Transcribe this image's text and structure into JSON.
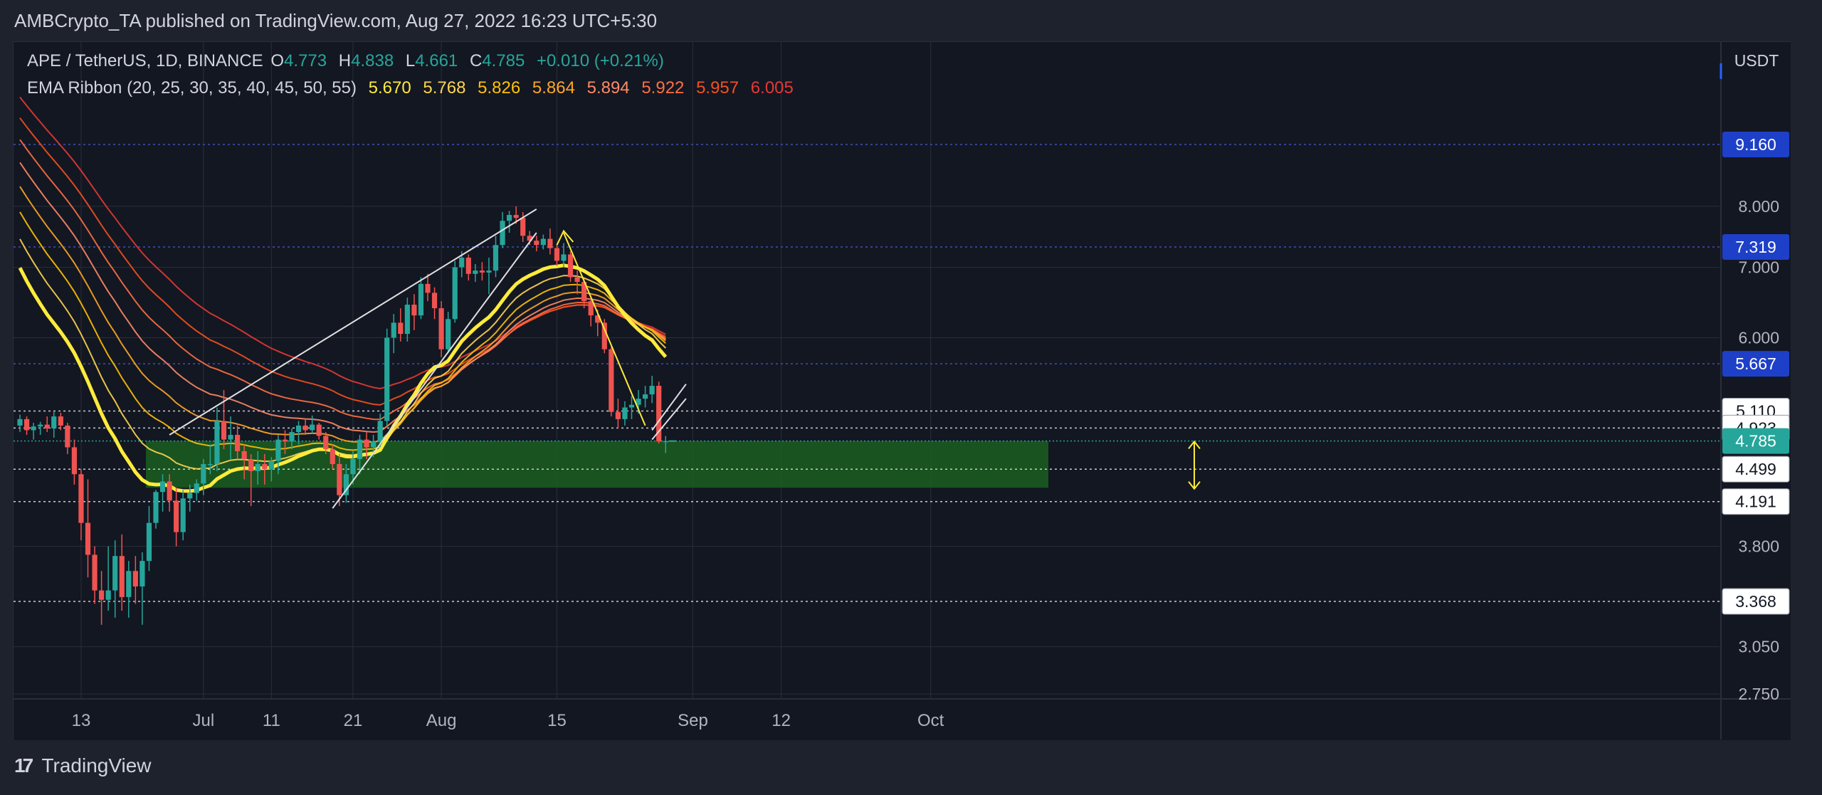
{
  "header": {
    "published": "AMBCrypto_TA published on TradingView.com, Aug 27, 2022 16:23 UTC+5:30"
  },
  "legend": {
    "symbol": "APE / TetherUS, 1D, BINANCE",
    "open_label": "O",
    "open": "4.773",
    "high_label": "H",
    "high": "4.838",
    "low_label": "L",
    "low": "4.661",
    "close_label": "C",
    "close": "4.785",
    "change": "+0.010 (+0.21%)",
    "ema_title": "EMA Ribbon (20, 25, 30, 35, 40, 45, 50, 55)",
    "ema_values": [
      "5.670",
      "5.768",
      "5.826",
      "5.864",
      "5.894",
      "5.922",
      "5.957",
      "6.005"
    ],
    "ema_colors": [
      "#ffeb3b",
      "#ffd54f",
      "#ffc107",
      "#ffa726",
      "#ff8a65",
      "#ff7043",
      "#f4511e",
      "#e53935"
    ]
  },
  "footer": {
    "brand": "TradingView",
    "logo": "17"
  },
  "colors": {
    "up": "#26a69a",
    "down": "#ef5350",
    "bg": "#131722",
    "grid": "#2a2e39",
    "zone": "#1b5e20",
    "highlight": "#2962ff",
    "label_bg": "#ffffff",
    "current": "#26a69a"
  },
  "chart_data": {
    "type": "candlestick",
    "currency": "USDT",
    "x_tick_labels": [
      "13",
      "Jul",
      "11",
      "21",
      "Aug",
      "15",
      "Sep",
      "12",
      "Oct"
    ],
    "y_tick_labels": [
      "2.750",
      "3.050",
      "3.800",
      "6.000",
      "7.000",
      "8.000"
    ],
    "price_labels": [
      {
        "value": "9.160",
        "style": "blue"
      },
      {
        "value": "7.319",
        "style": "blue"
      },
      {
        "value": "5.667",
        "style": "blue"
      },
      {
        "value": "5.110",
        "style": "white"
      },
      {
        "value": "4.923",
        "style": "white"
      },
      {
        "value": "4.785",
        "style": "current"
      },
      {
        "value": "4.499",
        "style": "white"
      },
      {
        "value": "4.191",
        "style": "white"
      },
      {
        "value": "3.368",
        "style": "white"
      }
    ],
    "candles": [
      {
        "d": "Jun 04",
        "o": 4.95,
        "h": 5.07,
        "l": 4.88,
        "c": 5.02
      },
      {
        "d": "Jun 05",
        "o": 5.02,
        "h": 5.05,
        "l": 4.85,
        "c": 4.9
      },
      {
        "d": "Jun 06",
        "o": 4.9,
        "h": 4.98,
        "l": 4.8,
        "c": 4.94
      },
      {
        "d": "Jun 07",
        "o": 4.94,
        "h": 4.99,
        "l": 4.85,
        "c": 4.96
      },
      {
        "d": "Jun 08",
        "o": 4.96,
        "h": 5.05,
        "l": 4.88,
        "c": 4.92
      },
      {
        "d": "Jun 09",
        "o": 4.92,
        "h": 5.1,
        "l": 4.82,
        "c": 5.05
      },
      {
        "d": "Jun 10",
        "o": 5.05,
        "h": 5.09,
        "l": 4.9,
        "c": 4.95
      },
      {
        "d": "Jun 11",
        "o": 4.95,
        "h": 4.98,
        "l": 4.65,
        "c": 4.72
      },
      {
        "d": "Jun 12",
        "o": 4.72,
        "h": 4.8,
        "l": 4.35,
        "c": 4.45
      },
      {
        "d": "Jun 13",
        "o": 4.45,
        "h": 4.5,
        "l": 3.85,
        "c": 4.0
      },
      {
        "d": "Jun 14",
        "o": 4.0,
        "h": 4.4,
        "l": 3.55,
        "c": 3.73
      },
      {
        "d": "Jun 15",
        "o": 3.73,
        "h": 3.8,
        "l": 3.35,
        "c": 3.45
      },
      {
        "d": "Jun 16",
        "o": 3.45,
        "h": 3.6,
        "l": 3.2,
        "c": 3.38
      },
      {
        "d": "Jun 17",
        "o": 3.38,
        "h": 3.8,
        "l": 3.3,
        "c": 3.45
      },
      {
        "d": "Jun 18",
        "o": 3.45,
        "h": 3.85,
        "l": 3.25,
        "c": 3.72
      },
      {
        "d": "Jun 19",
        "o": 3.72,
        "h": 3.9,
        "l": 3.3,
        "c": 3.4
      },
      {
        "d": "Jun 20",
        "o": 3.4,
        "h": 3.68,
        "l": 3.25,
        "c": 3.6
      },
      {
        "d": "Jun 21",
        "o": 3.6,
        "h": 3.72,
        "l": 3.35,
        "c": 3.48
      },
      {
        "d": "Jun 22",
        "o": 3.48,
        "h": 3.75,
        "l": 3.2,
        "c": 3.68
      },
      {
        "d": "Jun 23",
        "o": 3.68,
        "h": 4.15,
        "l": 3.6,
        "c": 4.0
      },
      {
        "d": "Jun 24",
        "o": 4.0,
        "h": 4.3,
        "l": 3.95,
        "c": 4.28
      },
      {
        "d": "Jun 25",
        "o": 4.28,
        "h": 4.45,
        "l": 4.1,
        "c": 4.38
      },
      {
        "d": "Jun 26",
        "o": 4.38,
        "h": 4.45,
        "l": 4.1,
        "c": 4.2
      },
      {
        "d": "Jun 27",
        "o": 4.2,
        "h": 4.32,
        "l": 3.8,
        "c": 3.92
      },
      {
        "d": "Jun 28",
        "o": 3.92,
        "h": 4.3,
        "l": 3.85,
        "c": 4.22
      },
      {
        "d": "Jun 29",
        "o": 4.22,
        "h": 4.35,
        "l": 4.1,
        "c": 4.27
      },
      {
        "d": "Jun 30",
        "o": 4.27,
        "h": 4.4,
        "l": 4.2,
        "c": 4.36
      },
      {
        "d": "Jul 01",
        "o": 4.36,
        "h": 4.6,
        "l": 4.25,
        "c": 4.55
      },
      {
        "d": "Jul 02",
        "o": 4.55,
        "h": 4.75,
        "l": 4.45,
        "c": 4.55
      },
      {
        "d": "Jul 03",
        "o": 4.55,
        "h": 5.15,
        "l": 4.48,
        "c": 5.0
      },
      {
        "d": "Jul 04",
        "o": 5.0,
        "h": 5.35,
        "l": 4.7,
        "c": 4.8
      },
      {
        "d": "Jul 05",
        "o": 4.8,
        "h": 5.05,
        "l": 4.6,
        "c": 4.85
      },
      {
        "d": "Jul 06",
        "o": 4.85,
        "h": 4.95,
        "l": 4.6,
        "c": 4.68
      },
      {
        "d": "Jul 07",
        "o": 4.68,
        "h": 4.75,
        "l": 4.4,
        "c": 4.6
      },
      {
        "d": "Jul 08",
        "o": 4.6,
        "h": 4.65,
        "l": 4.15,
        "c": 4.48
      },
      {
        "d": "Jul 09",
        "o": 4.48,
        "h": 4.68,
        "l": 4.35,
        "c": 4.55
      },
      {
        "d": "Jul 10",
        "o": 4.55,
        "h": 4.65,
        "l": 4.35,
        "c": 4.5
      },
      {
        "d": "Jul 11",
        "o": 4.5,
        "h": 4.62,
        "l": 4.38,
        "c": 4.58
      },
      {
        "d": "Jul 12",
        "o": 4.58,
        "h": 4.85,
        "l": 4.45,
        "c": 4.8
      },
      {
        "d": "Jul 13",
        "o": 4.8,
        "h": 4.9,
        "l": 4.65,
        "c": 4.78
      },
      {
        "d": "Jul 14",
        "o": 4.78,
        "h": 4.92,
        "l": 4.7,
        "c": 4.88
      },
      {
        "d": "Jul 15",
        "o": 4.88,
        "h": 5.0,
        "l": 4.75,
        "c": 4.95
      },
      {
        "d": "Jul 16",
        "o": 4.95,
        "h": 5.02,
        "l": 4.85,
        "c": 4.9
      },
      {
        "d": "Jul 17",
        "o": 4.9,
        "h": 5.06,
        "l": 4.86,
        "c": 4.96
      },
      {
        "d": "Jul 18",
        "o": 4.96,
        "h": 4.98,
        "l": 4.8,
        "c": 4.84
      },
      {
        "d": "Jul 19",
        "o": 4.84,
        "h": 4.88,
        "l": 4.65,
        "c": 4.7
      },
      {
        "d": "Jul 20",
        "o": 4.7,
        "h": 4.75,
        "l": 4.5,
        "c": 4.55
      },
      {
        "d": "Jul 21",
        "o": 4.55,
        "h": 4.65,
        "l": 4.15,
        "c": 4.25
      },
      {
        "d": "Jul 22",
        "o": 4.25,
        "h": 4.55,
        "l": 4.18,
        "c": 4.45
      },
      {
        "d": "Jul 23",
        "o": 4.45,
        "h": 4.68,
        "l": 4.35,
        "c": 4.6
      },
      {
        "d": "Jul 24",
        "o": 4.6,
        "h": 4.85,
        "l": 4.45,
        "c": 4.8
      },
      {
        "d": "Jul 25",
        "o": 4.8,
        "h": 4.88,
        "l": 4.6,
        "c": 4.72
      },
      {
        "d": "Jul 26",
        "o": 4.72,
        "h": 4.85,
        "l": 4.62,
        "c": 4.78
      },
      {
        "d": "Jul 27",
        "o": 4.78,
        "h": 5.08,
        "l": 4.72,
        "c": 5.0
      },
      {
        "d": "Jul 28",
        "o": 5.0,
        "h": 6.12,
        "l": 4.95,
        "c": 6.0
      },
      {
        "d": "Jul 29",
        "o": 6.0,
        "h": 6.32,
        "l": 5.8,
        "c": 6.2
      },
      {
        "d": "Jul 30",
        "o": 6.2,
        "h": 6.4,
        "l": 5.95,
        "c": 6.05
      },
      {
        "d": "Jul 31",
        "o": 6.05,
        "h": 6.55,
        "l": 5.95,
        "c": 6.45
      },
      {
        "d": "Aug 01",
        "o": 6.45,
        "h": 6.6,
        "l": 6.1,
        "c": 6.3
      },
      {
        "d": "Aug 02",
        "o": 6.3,
        "h": 6.85,
        "l": 6.25,
        "c": 6.75
      },
      {
        "d": "Aug 03",
        "o": 6.75,
        "h": 6.9,
        "l": 6.5,
        "c": 6.62
      },
      {
        "d": "Aug 04",
        "o": 6.62,
        "h": 6.7,
        "l": 6.25,
        "c": 6.4
      },
      {
        "d": "Aug 05",
        "o": 6.4,
        "h": 6.5,
        "l": 5.75,
        "c": 5.85
      },
      {
        "d": "Aug 06",
        "o": 5.85,
        "h": 6.35,
        "l": 5.8,
        "c": 6.25
      },
      {
        "d": "Aug 07",
        "o": 6.25,
        "h": 7.1,
        "l": 6.2,
        "c": 7.0
      },
      {
        "d": "Aug 08",
        "o": 7.0,
        "h": 7.25,
        "l": 6.85,
        "c": 7.15
      },
      {
        "d": "Aug 09",
        "o": 7.15,
        "h": 7.2,
        "l": 6.8,
        "c": 6.9
      },
      {
        "d": "Aug 10",
        "o": 6.9,
        "h": 7.05,
        "l": 6.78,
        "c": 6.95
      },
      {
        "d": "Aug 11",
        "o": 6.95,
        "h": 7.08,
        "l": 6.8,
        "c": 6.92
      },
      {
        "d": "Aug 12",
        "o": 6.92,
        "h": 7.15,
        "l": 6.6,
        "c": 6.95
      },
      {
        "d": "Aug 13",
        "o": 6.95,
        "h": 7.5,
        "l": 6.85,
        "c": 7.35
      },
      {
        "d": "Aug 14",
        "o": 7.35,
        "h": 7.9,
        "l": 7.3,
        "c": 7.75
      },
      {
        "d": "Aug 15",
        "o": 7.75,
        "h": 7.92,
        "l": 7.55,
        "c": 7.85
      },
      {
        "d": "Aug 16",
        "o": 7.85,
        "h": 8.0,
        "l": 7.7,
        "c": 7.8
      },
      {
        "d": "Aug 17",
        "o": 7.8,
        "h": 7.9,
        "l": 7.4,
        "c": 7.5
      },
      {
        "d": "Aug 18",
        "o": 7.5,
        "h": 7.58,
        "l": 7.35,
        "c": 7.42
      },
      {
        "d": "Aug 19",
        "o": 7.42,
        "h": 7.5,
        "l": 7.25,
        "c": 7.35
      },
      {
        "d": "Aug 20",
        "o": 7.35,
        "h": 7.52,
        "l": 7.28,
        "c": 7.45
      },
      {
        "d": "Aug 21",
        "o": 7.45,
        "h": 7.62,
        "l": 7.2,
        "c": 7.3
      },
      {
        "d": "Aug 22",
        "o": 7.3,
        "h": 7.35,
        "l": 7.02,
        "c": 7.1
      },
      {
        "d": "Aug 23",
        "o": 7.1,
        "h": 7.38,
        "l": 7.0,
        "c": 7.2
      },
      {
        "d": "Aug 24",
        "o": 7.2,
        "h": 7.25,
        "l": 6.78,
        "c": 6.85
      },
      {
        "d": "Aug 25",
        "o": 6.85,
        "h": 6.95,
        "l": 6.6,
        "c": 6.78
      },
      {
        "d": "Aug 26",
        "o": 6.78,
        "h": 6.82,
        "l": 6.4,
        "c": 6.5
      },
      {
        "d": "Aug 27",
        "o": 6.5,
        "h": 6.55,
        "l": 6.15,
        "c": 6.3
      },
      {
        "d": "Aug 28",
        "o": 6.3,
        "h": 6.38,
        "l": 6.02,
        "c": 6.2
      },
      {
        "d": "Aug 29",
        "o": 6.2,
        "h": 6.25,
        "l": 5.8,
        "c": 5.85
      },
      {
        "d": "Aug 30",
        "o": 5.85,
        "h": 5.88,
        "l": 5.05,
        "c": 5.1
      },
      {
        "d": "Aug 31",
        "o": 5.1,
        "h": 5.25,
        "l": 4.92,
        "c": 5.02
      },
      {
        "d": "Sep 01",
        "o": 5.02,
        "h": 5.22,
        "l": 4.95,
        "c": 5.15
      },
      {
        "d": "Sep 02",
        "o": 5.15,
        "h": 5.28,
        "l": 5.02,
        "c": 5.18
      },
      {
        "d": "Sep 03",
        "o": 5.18,
        "h": 5.35,
        "l": 5.08,
        "c": 5.25
      },
      {
        "d": "Sep 04",
        "o": 5.25,
        "h": 5.4,
        "l": 5.15,
        "c": 5.3
      },
      {
        "d": "Sep 05",
        "o": 5.3,
        "h": 5.52,
        "l": 5.2,
        "c": 5.4
      },
      {
        "d": "Sep 06",
        "o": 5.4,
        "h": 5.45,
        "l": 4.76,
        "c": 4.78
      },
      {
        "d": "Sep 07",
        "o": 4.773,
        "h": 4.838,
        "l": 4.661,
        "c": 4.785
      }
    ]
  }
}
